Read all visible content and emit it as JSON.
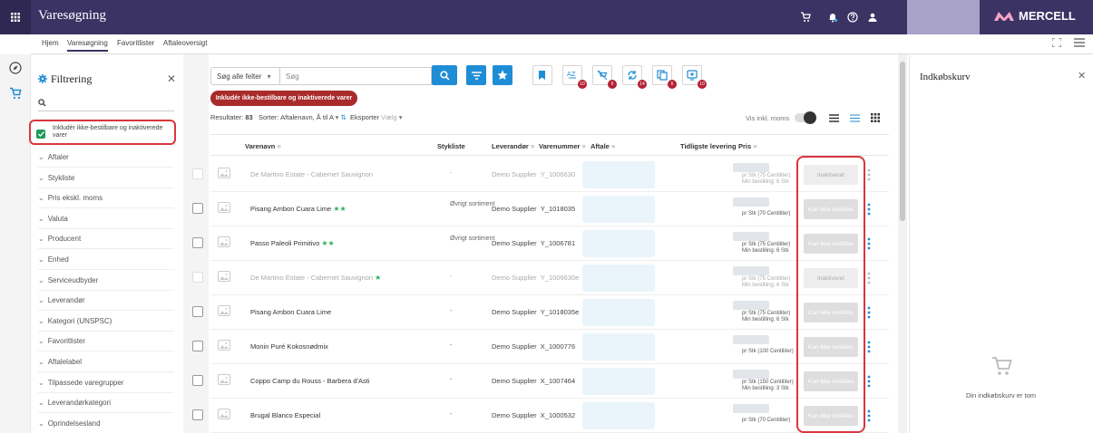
{
  "app": {
    "title": "Varesøgning",
    "brand": "MERCELL",
    "brand_color": "#3b3364"
  },
  "nav": {
    "items": [
      "Hjem",
      "Varesøgning",
      "Favoritlister",
      "Aftaleoversigt"
    ],
    "active": "Varesøgning"
  },
  "filter": {
    "title": "Filtrering",
    "search_placeholder": "",
    "include_inactive_label": "Inkludér ikke-bestilbare og inaktiverede varer",
    "include_inactive_checked": true,
    "sections": [
      "Aftaler",
      "Stykliste",
      "Pris ekskl. moms",
      "Valuta",
      "Producent",
      "Enhed",
      "Serviceudbyder",
      "Leverandør",
      "Kategori (UNSPSC)",
      "Favoritlister",
      "Aftalelabel",
      "Tilpassede varegrupper",
      "Leverandørkategori",
      "Oprindelsesland"
    ]
  },
  "search": {
    "field_select": "Søg alle felter",
    "placeholder": "Søg"
  },
  "toolbar": {
    "badges": [
      "10",
      "6",
      "14",
      "6",
      "10"
    ]
  },
  "include_button": "Inkludér ikke-bestilbare og inaktiverede varer",
  "results": {
    "label": "Resultater:",
    "count": "83",
    "sort_label": "Sorter:",
    "sort_value": "Aftalenavn, Å til A",
    "export_label": "Eksporter",
    "export_value": "Vælg",
    "vat_label": "Vis inkl. moms"
  },
  "table": {
    "headers": {
      "name": "Varenavn",
      "bom": "Stykliste",
      "supplier": "Leverandør",
      "item_no": "Varenummer",
      "agreement": "Aftale",
      "delivery": "Tidligste levering",
      "price": "Pris"
    },
    "rows": [
      {
        "name": "De Martino Estate - Cabernet Sauvignon",
        "stars": "",
        "bom": "-",
        "supplier": "Demo Supplier",
        "item_no": "Y_1006630",
        "price_unit": "pr Stk (75 Centiliter)",
        "min_order": "Min bestilling: 6 Stk",
        "status": "Inaktiveret",
        "inactive": true
      },
      {
        "name": "Pisang Ambon Cuara Lime",
        "stars": "★★",
        "bom": "Øvrigt sortiment",
        "supplier": "Demo Supplier",
        "item_no": "Y_1018035",
        "price_unit": "pr Stk (70 Centiliter)",
        "min_order": "",
        "status": "Kan ikke bestilles",
        "inactive": false
      },
      {
        "name": "Passo Paleoli Primitivo",
        "stars": "★★",
        "bom": "Øvrigt sortiment",
        "supplier": "Demo Supplier",
        "item_no": "Y_1006781",
        "price_unit": "pr Stk (75 Centiliter)",
        "min_order": "Min bestilling: 6 Stk",
        "status": "Kan ikke bestilles",
        "inactive": false
      },
      {
        "name": "De Martino Estate - Cabernet Sauvignon",
        "stars": "★",
        "bom": "-",
        "supplier": "Demo Supplier",
        "item_no": "Y_1006630e",
        "price_unit": "pr Stk (75 Centiliter)",
        "min_order": "Min bestilling: 6 Stk",
        "status": "Inaktiveret",
        "inactive": true
      },
      {
        "name": "Pisang Ambon Cuara Lime",
        "stars": "",
        "bom": "-",
        "supplier": "Demo Supplier",
        "item_no": "Y_1018035e",
        "price_unit": "pr Stk (75 Centiliter)",
        "min_order": "Min bestilling: 6 Stk",
        "status": "Kan ikke bestilles",
        "inactive": false
      },
      {
        "name": "Monin Puré Kokosnødmix",
        "stars": "",
        "bom": "-",
        "supplier": "Demo Supplier",
        "item_no": "X_1000776",
        "price_unit": "pr Stk (100 Centiliter)",
        "min_order": "",
        "status": "Kan ikke bestilles",
        "inactive": false
      },
      {
        "name": "Coppo Camp du Rouss - Barbera d'Asti",
        "stars": "",
        "bom": "-",
        "supplier": "Demo Supplier",
        "item_no": "X_1007464",
        "price_unit": "pr Stk (150 Centiliter)",
        "min_order": "Min bestilling: 3 Stk",
        "status": "Kan ikke bestilles",
        "inactive": false
      },
      {
        "name": "Brugal Blanco Especial",
        "stars": "",
        "bom": "-",
        "supplier": "Demo Supplier",
        "item_no": "X_1000532",
        "price_unit": "pr Stk (70 Centiliter)",
        "min_order": "",
        "status": "Kan ikke bestilles",
        "inactive": false
      }
    ]
  },
  "cart": {
    "title": "Indkøbskurv",
    "empty_text": "Din indkøbskurv er tom"
  }
}
